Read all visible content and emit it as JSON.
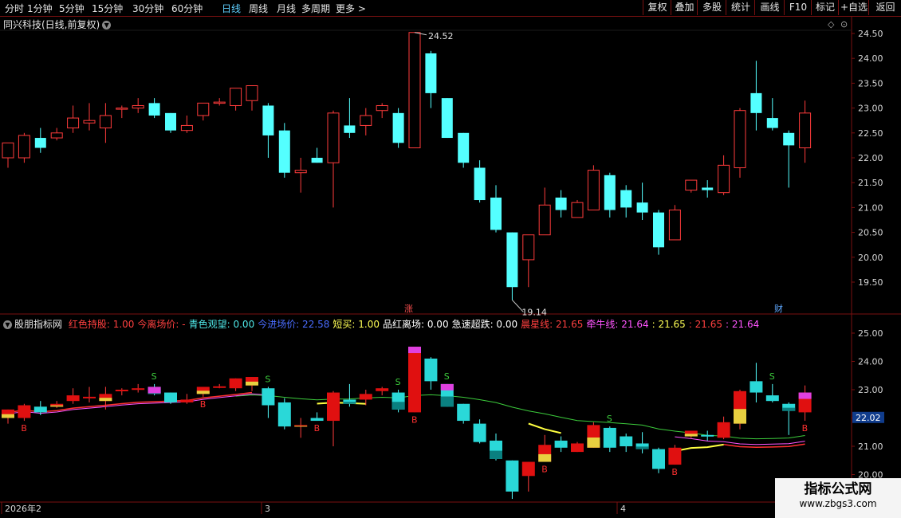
{
  "toolbar": {
    "period_tabs": [
      "分时",
      "1分钟",
      "5分钟",
      "15分钟",
      "30分钟",
      "60分钟",
      "日线",
      "周线",
      "月线",
      "多周期",
      "更多 >"
    ],
    "active_tab": "日线",
    "right_buttons": [
      "复权",
      "叠加",
      "多股",
      "统计",
      "画线",
      "F10",
      "标记",
      "+自选",
      "返回"
    ]
  },
  "main_chart": {
    "title": "同兴科技(日线,前复权)",
    "y_ticks": [
      "24.50",
      "24.00",
      "23.50",
      "23.00",
      "22.50",
      "22.00",
      "21.50",
      "21.00",
      "20.50",
      "20.00",
      "19.50"
    ],
    "high_label": "24.52",
    "low_label": "19.14",
    "event_marks": [
      "涨",
      "财"
    ]
  },
  "indicator": {
    "name": "股朋指标网",
    "items": [
      {
        "text": "红色持股: 1.00",
        "color": "#ff4040"
      },
      {
        "text": "今离场价: -",
        "color": "#ff4040"
      },
      {
        "text": "青色观望: 0.00",
        "color": "#4fe8e8"
      },
      {
        "text": "今进场价: 22.58",
        "color": "#4a6cff"
      },
      {
        "text": "短买: 1.00",
        "color": "#ffff55"
      },
      {
        "text": "品红离场: 0.00",
        "color": "#ffffff"
      },
      {
        "text": "急速超跌: 0.00",
        "color": "#ffffff"
      },
      {
        "text": "晨星线: 21.65",
        "color": "#ff4040"
      },
      {
        "text": "牵牛线: 21.64",
        "color": "#ff55ff"
      },
      {
        "text": ": 21.65",
        "color": "#ffff55"
      },
      {
        "text": ": 21.65",
        "color": "#ff4040"
      },
      {
        "text": ": 21.64",
        "color": "#ff55ff"
      }
    ],
    "y_ticks": [
      "25.00",
      "24.00",
      "23.00",
      "22.00",
      "21.00",
      "20.00"
    ],
    "current_price": "22.02",
    "signal_s": "S",
    "signal_b": "B"
  },
  "x_axis": {
    "labels": [
      "2026年2",
      "3",
      "4"
    ]
  },
  "watermark": {
    "line1": "指标公式网",
    "line2": "www.zbgs3.com"
  },
  "chart_data": {
    "type": "candlestick",
    "title": "同兴科技(日线,前复权)",
    "ylim": [
      19.0,
      24.7
    ],
    "candles": [
      {
        "o": 22.0,
        "h": 22.3,
        "l": 21.8,
        "c": 22.3
      },
      {
        "o": 22.0,
        "h": 22.5,
        "l": 21.9,
        "c": 22.45
      },
      {
        "o": 22.4,
        "h": 22.6,
        "l": 22.1,
        "c": 22.2
      },
      {
        "o": 22.4,
        "h": 22.6,
        "l": 22.35,
        "c": 22.5
      },
      {
        "o": 22.6,
        "h": 23.05,
        "l": 22.5,
        "c": 22.8
      },
      {
        "o": 22.7,
        "h": 23.1,
        "l": 22.55,
        "c": 22.75
      },
      {
        "o": 22.6,
        "h": 23.1,
        "l": 22.3,
        "c": 22.85
      },
      {
        "o": 23.0,
        "h": 23.05,
        "l": 22.8,
        "c": 23.0
      },
      {
        "o": 23.0,
        "h": 23.2,
        "l": 22.9,
        "c": 23.05
      },
      {
        "o": 23.1,
        "h": 23.2,
        "l": 22.8,
        "c": 22.85
      },
      {
        "o": 22.9,
        "h": 22.9,
        "l": 22.5,
        "c": 22.55
      },
      {
        "o": 22.55,
        "h": 22.85,
        "l": 22.5,
        "c": 22.65
      },
      {
        "o": 22.85,
        "h": 23.1,
        "l": 22.75,
        "c": 23.1
      },
      {
        "o": 23.1,
        "h": 23.2,
        "l": 23.05,
        "c": 23.12
      },
      {
        "o": 23.05,
        "h": 23.4,
        "l": 22.95,
        "c": 23.4
      },
      {
        "o": 23.15,
        "h": 23.45,
        "l": 22.95,
        "c": 23.45
      },
      {
        "o": 23.05,
        "h": 23.1,
        "l": 22.0,
        "c": 22.45
      },
      {
        "o": 22.55,
        "h": 22.7,
        "l": 21.6,
        "c": 21.7
      },
      {
        "o": 21.7,
        "h": 22.0,
        "l": 21.3,
        "c": 21.75
      },
      {
        "o": 22.0,
        "h": 22.2,
        "l": 21.9,
        "c": 21.9
      },
      {
        "o": 21.9,
        "h": 22.95,
        "l": 21.0,
        "c": 22.9
      },
      {
        "o": 22.65,
        "h": 23.2,
        "l": 22.4,
        "c": 22.5
      },
      {
        "o": 22.65,
        "h": 23.0,
        "l": 22.45,
        "c": 22.85
      },
      {
        "o": 22.95,
        "h": 23.1,
        "l": 22.8,
        "c": 23.05
      },
      {
        "o": 22.9,
        "h": 23.0,
        "l": 22.2,
        "c": 22.3
      },
      {
        "o": 22.2,
        "h": 24.52,
        "l": 22.2,
        "c": 24.52
      },
      {
        "o": 24.1,
        "h": 24.15,
        "l": 23.0,
        "c": 23.3
      },
      {
        "o": 23.2,
        "h": 23.2,
        "l": 22.4,
        "c": 22.4
      },
      {
        "o": 22.5,
        "h": 22.5,
        "l": 21.8,
        "c": 21.9
      },
      {
        "o": 21.8,
        "h": 21.95,
        "l": 21.1,
        "c": 21.15
      },
      {
        "o": 21.2,
        "h": 21.45,
        "l": 20.5,
        "c": 20.55
      },
      {
        "o": 20.5,
        "h": 20.5,
        "l": 19.14,
        "c": 19.4
      },
      {
        "o": 19.95,
        "h": 20.45,
        "l": 19.4,
        "c": 20.45
      },
      {
        "o": 20.45,
        "h": 21.4,
        "l": 20.45,
        "c": 21.05
      },
      {
        "o": 21.2,
        "h": 21.35,
        "l": 20.8,
        "c": 20.95
      },
      {
        "o": 20.8,
        "h": 21.15,
        "l": 20.8,
        "c": 21.1
      },
      {
        "o": 20.95,
        "h": 21.85,
        "l": 20.95,
        "c": 21.75
      },
      {
        "o": 21.65,
        "h": 21.7,
        "l": 20.8,
        "c": 20.95
      },
      {
        "o": 21.35,
        "h": 21.45,
        "l": 20.8,
        "c": 21.0
      },
      {
        "o": 21.1,
        "h": 21.5,
        "l": 20.75,
        "c": 20.9
      },
      {
        "o": 20.9,
        "h": 20.95,
        "l": 20.05,
        "c": 20.2
      },
      {
        "o": 20.35,
        "h": 21.05,
        "l": 20.35,
        "c": 20.95
      },
      {
        "o": 21.35,
        "h": 21.55,
        "l": 21.3,
        "c": 21.55
      },
      {
        "o": 21.4,
        "h": 21.55,
        "l": 21.2,
        "c": 21.35
      },
      {
        "o": 21.3,
        "h": 22.05,
        "l": 21.25,
        "c": 21.85
      },
      {
        "o": 21.8,
        "h": 23.0,
        "l": 21.6,
        "c": 22.95
      },
      {
        "o": 23.3,
        "h": 23.95,
        "l": 22.55,
        "c": 22.9
      },
      {
        "o": 22.8,
        "h": 23.2,
        "l": 22.55,
        "c": 22.6
      },
      {
        "o": 22.5,
        "h": 22.55,
        "l": 21.4,
        "c": 22.25
      },
      {
        "o": 22.2,
        "h": 23.15,
        "l": 21.9,
        "c": 22.9
      }
    ]
  }
}
